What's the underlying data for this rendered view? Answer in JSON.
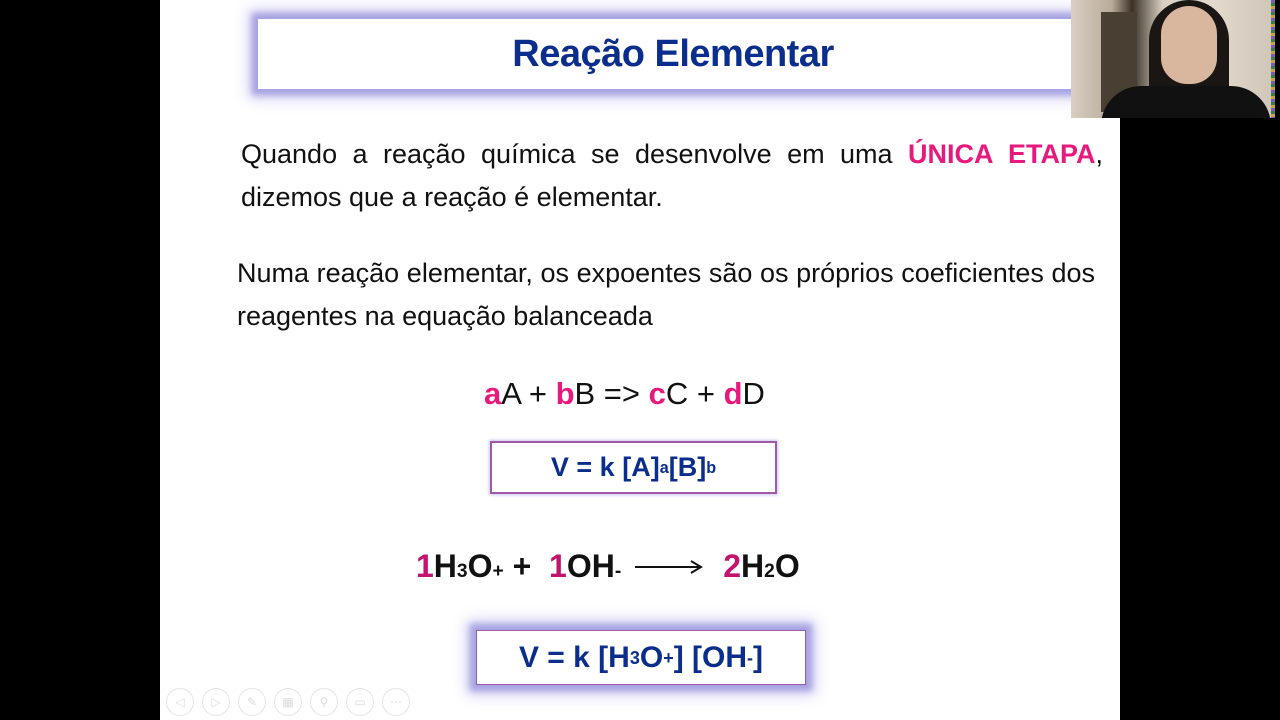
{
  "slide": {
    "title": "Reação Elementar",
    "paragraph1": {
      "before": "Quando a reação química se desenvolve em uma ",
      "highlight": "ÚNICA ETAPA",
      "after": ", dizemos que a reação é elementar."
    },
    "paragraph2": "Numa reação elementar, os expoentes são os próprios coeficientes dos reagentes na equação balanceada",
    "general_equation": {
      "coef_a": "a",
      "species_a": "A",
      "plus1": " + ",
      "coef_b": "b",
      "species_b": "B",
      "arrow": " => ",
      "coef_c": "c",
      "species_c": "C",
      "plus2": " + ",
      "coef_d": "d",
      "species_d": "D"
    },
    "general_rate_law": {
      "prefix": "V = k [A]",
      "exp_a": "a",
      "middle": " [B]",
      "exp_b": "b"
    },
    "example_equation": {
      "coef1": "1",
      "reactant1_a": " H",
      "reactant1_sub": "3",
      "reactant1_b": "O",
      "reactant1_sup": "+",
      "plus": " +  ",
      "coef2": "1",
      "reactant2": "OH",
      "reactant2_sup": "-",
      "coef3": "2",
      "product_a": " H",
      "product_sub": "2",
      "product_b": "O"
    },
    "example_rate_law": {
      "prefix": "V = k [H",
      "sub": "3",
      "mid": "O",
      "sup1": "+",
      "mid2": "] [OH",
      "sup2": "-",
      "end": "]"
    }
  },
  "slideshow_controls": [
    {
      "name": "previous-slide",
      "glyph": "◁"
    },
    {
      "name": "next-slide",
      "glyph": "▷"
    },
    {
      "name": "pen-tool",
      "glyph": "✎"
    },
    {
      "name": "see-all-slides",
      "glyph": "▦"
    },
    {
      "name": "zoom",
      "glyph": "⚲"
    },
    {
      "name": "subtitles",
      "glyph": "▭"
    },
    {
      "name": "more-options",
      "glyph": "⋯"
    }
  ],
  "colors": {
    "title": "#0b2e8c",
    "highlight_pink": "#e8197d",
    "glow": "#a7a3e2"
  }
}
